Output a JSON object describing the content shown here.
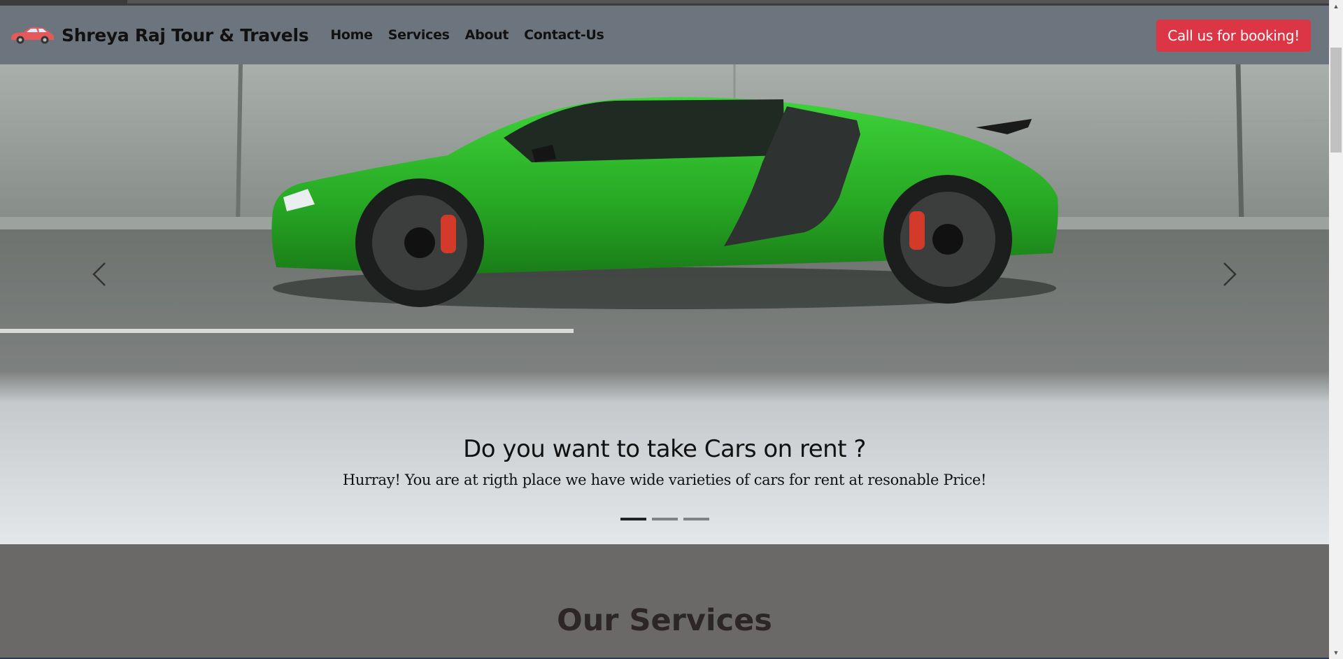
{
  "navbar": {
    "brand": "Shreya Raj Tour & Travels",
    "brand_icon": "car-icon",
    "links": [
      "Home",
      "Services",
      "About",
      "Contact-Us"
    ],
    "cta_label": "Call us for booking!"
  },
  "carousel": {
    "heading": "Do you want to take Cars on rent ?",
    "text": "Hurray! You are at rigth place we have wide varieties of cars for rent at resonable Price!",
    "active_index": 0,
    "slide_count": 3,
    "prev_icon": "chevron-left-icon",
    "next_icon": "chevron-right-icon"
  },
  "services": {
    "heading": "Our Services"
  },
  "colors": {
    "navbar_bg": "#6c757d",
    "cta_bg": "#dc3545",
    "car_green": "#2fb82f",
    "section_bg": "#6b6868"
  }
}
